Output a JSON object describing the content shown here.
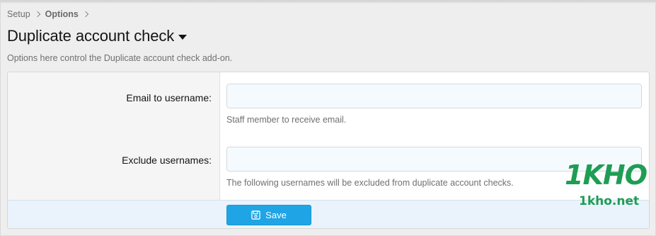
{
  "breadcrumb": {
    "items": [
      {
        "label": "Setup"
      },
      {
        "label": "Options"
      }
    ]
  },
  "page": {
    "title": "Duplicate account check",
    "description": "Options here control the Duplicate account check add-on."
  },
  "form": {
    "fields": [
      {
        "label": "Email to username:",
        "value": "",
        "hint": "Staff member to receive email."
      },
      {
        "label": "Exclude usernames:",
        "value": "",
        "hint": "The following usernames will be excluded from duplicate account checks."
      }
    ],
    "save_label": "Save"
  },
  "watermark": {
    "logo": "1KHO",
    "site": "1kho.net"
  },
  "colors": {
    "accent": "#1fa5e6",
    "label_bg": "#f5f5f5",
    "submit_bg": "#eaf3fb",
    "watermark": "#1f9d55"
  },
  "icons": {
    "breadcrumb_separator": "chevron-right-icon",
    "title_menu": "caret-down-icon",
    "save": "save-icon"
  }
}
